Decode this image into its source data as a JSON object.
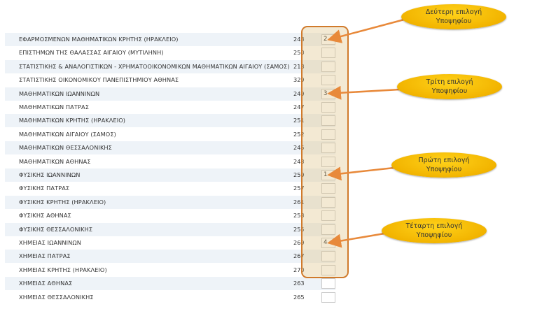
{
  "rows": [
    {
      "name": "ΕΦΑΡΜΟΣΜΕΝΩΝ ΜΑΘΗΜΑΤΙΚΩΝ ΚΡΗΤΗΣ (ΗΡΑΚΛΕΙΟ)",
      "code": "248",
      "choice": "2"
    },
    {
      "name": "ΕΠΙΣΤΗΜΩΝ ΤΗΣ ΘΑΛΑΣΣΑΣ ΑΙΓΑΙΟΥ (ΜΥΤΙΛΗΝΗ)",
      "code": "250",
      "choice": ""
    },
    {
      "name": "ΣΤΑΤΙΣΤΙΚΗΣ & ΑΝΑΛΟΓΙΣΤΙΚΩΝ - ΧΡΗΜΑΤΟΟΙΚΟΝΟΜΙΚΩΝ ΜΑΘΗΜΑΤΙΚΩΝ ΑΙΓΑΙΟΥ (ΣΑΜΟΣ)",
      "code": "218",
      "choice": ""
    },
    {
      "name": "ΣΤΑΤΙΣΤΙΚΗΣ ΟΙΚΟΝΟΜΙΚΟΥ ΠΑΝΕΠΙΣΤΗΜΙΟΥ ΑΘΗΝΑΣ",
      "code": "329",
      "choice": ""
    },
    {
      "name": "ΜΑΘΗΜΑΤΙΚΩΝ ΙΩΑΝΝΙΝΩΝ",
      "code": "249",
      "choice": "3"
    },
    {
      "name": "ΜΑΘΗΜΑΤΙΚΩΝ ΠΑΤΡΑΣ",
      "code": "247",
      "choice": ""
    },
    {
      "name": "ΜΑΘΗΜΑΤΙΚΩΝ ΚΡΗΤΗΣ (ΗΡΑΚΛΕΙΟ)",
      "code": "251",
      "choice": ""
    },
    {
      "name": "ΜΑΘΗΜΑΤΙΚΩΝ ΑΙΓΑΙΟΥ (ΣΑΜΟΣ)",
      "code": "252",
      "choice": ""
    },
    {
      "name": "ΜΑΘΗΜΑΤΙΚΩΝ ΘΕΣΣΑΛΟΝΙΚΗΣ",
      "code": "245",
      "choice": ""
    },
    {
      "name": "ΜΑΘΗΜΑΤΙΚΩΝ ΑΘΗΝΑΣ",
      "code": "243",
      "choice": ""
    },
    {
      "name": "ΦΥΣΙΚΗΣ ΙΩΑΝΝΙΝΩΝ",
      "code": "259",
      "choice": "1"
    },
    {
      "name": "ΦΥΣΙΚΗΣ ΠΑΤΡΑΣ",
      "code": "257",
      "choice": ""
    },
    {
      "name": "ΦΥΣΙΚΗΣ ΚΡΗΤΗΣ (ΗΡΑΚΛΕΙΟ)",
      "code": "261",
      "choice": ""
    },
    {
      "name": "ΦΥΣΙΚΗΣ ΑΘΗΝΑΣ",
      "code": "253",
      "choice": ""
    },
    {
      "name": "ΦΥΣΙΚΗΣ ΘΕΣΣΑΛΟΝΙΚΗΣ",
      "code": "255",
      "choice": ""
    },
    {
      "name": "ΧΗΜΕΙΑΣ ΙΩΑΝΝΙΝΩΝ",
      "code": "269",
      "choice": "4"
    },
    {
      "name": "ΧΗΜΕΙΑΣ ΠΑΤΡΑΣ",
      "code": "267",
      "choice": ""
    },
    {
      "name": "ΧΗΜΕΙΑΣ ΚΡΗΤΗΣ (ΗΡΑΚΛΕΙΟ)",
      "code": "270",
      "choice": ""
    },
    {
      "name": "ΧΗΜΕΙΑΣ ΑΘΗΝΑΣ",
      "code": "263",
      "choice": ""
    },
    {
      "name": "ΧΗΜΕΙΑΣ ΘΕΣΣΑΛΟΝΙΚΗΣ",
      "code": "265",
      "choice": ""
    }
  ],
  "callouts": [
    {
      "line1": "Δεύτερη επιλογή",
      "line2": "Υποψηφίου",
      "target_row": 0
    },
    {
      "line1": "Τρίτη επιλογή",
      "line2": "Υποψηφίου",
      "target_row": 4
    },
    {
      "line1": "Πρώτη επιλογή",
      "line2": "Υποψηφίου",
      "target_row": 10
    },
    {
      "line1": "Τέταρτη επιλογή",
      "line2": "Υποψηφίου",
      "target_row": 15
    }
  ],
  "colors": {
    "highlight_border": "#d07a2b",
    "callout_fill": "#f2b400",
    "arrow": "#e8893a",
    "row_alt": "#eef3f8"
  }
}
